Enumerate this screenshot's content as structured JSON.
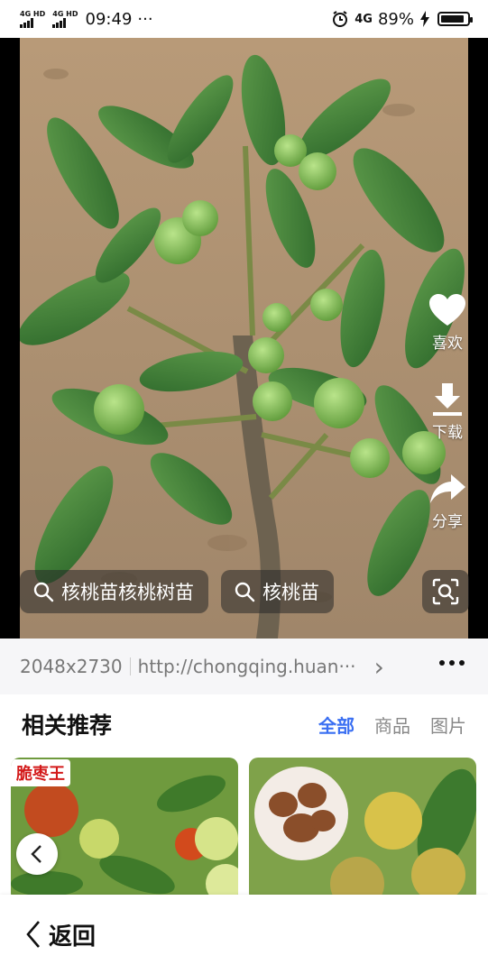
{
  "status_bar": {
    "network_1": "4G HD",
    "network_2": "4G HD",
    "time": "09:49",
    "more": "···",
    "network_3": "4G",
    "battery_percent": "89%",
    "battery_level": 0.89
  },
  "viewer": {
    "actions": [
      {
        "label": "喜欢",
        "icon": "heart-icon"
      },
      {
        "label": "下载",
        "icon": "download-icon"
      },
      {
        "label": "分享",
        "icon": "share-icon"
      }
    ],
    "search_chips": [
      {
        "label": "核桃苗核桃树苗",
        "icon": "search-icon"
      },
      {
        "label": "核桃苗",
        "icon": "search-icon"
      }
    ],
    "lens_icon": "image-search-icon"
  },
  "info": {
    "dimensions": "2048x2730",
    "url": "http://chongqing.huan···",
    "chevron": "›"
  },
  "related": {
    "title": "相关推荐",
    "tabs": [
      {
        "label": "全部",
        "active": true
      },
      {
        "label": "商品",
        "active": false
      },
      {
        "label": "图片",
        "active": false
      }
    ],
    "cards": [
      {
        "tag": "脆枣王"
      },
      {
        "tag": ""
      }
    ]
  },
  "bottom": {
    "back_label": "返回"
  },
  "colors": {
    "accent": "#3a6ff2",
    "tag_red": "#d31a1a",
    "info_bg": "#f6f6f8"
  }
}
